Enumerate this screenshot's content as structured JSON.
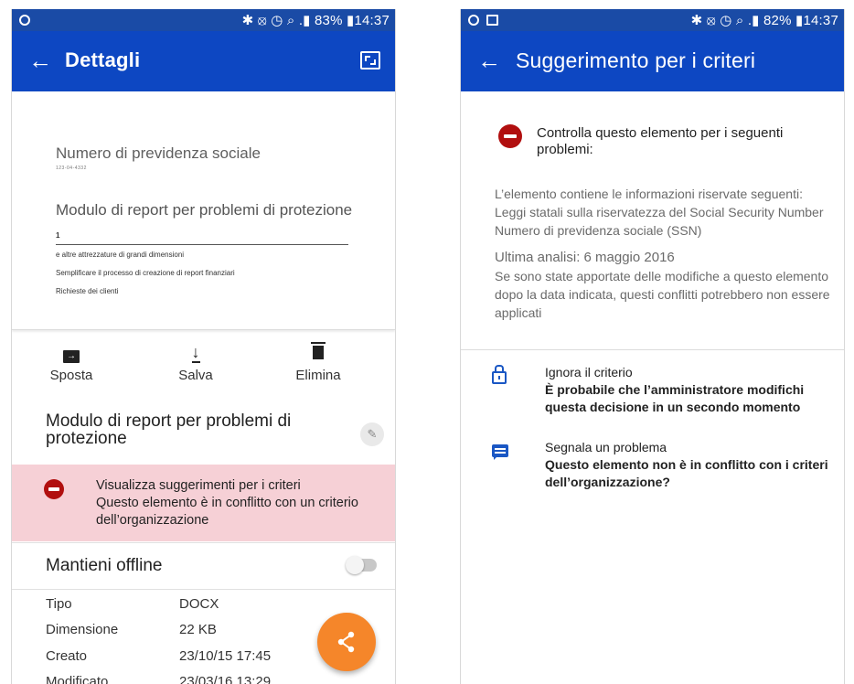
{
  "left": {
    "status_bar": {
      "right": "✱ ⦻ ◷ ⌕ .▮ 83% ▮14:37",
      "battery": "83%",
      "time": "14:37"
    },
    "app_bar": {
      "title": "Dettagli",
      "back_icon": "arrow-left-icon",
      "expand_icon": "expand-icon"
    },
    "preview": {
      "heading1": "Numero di previdenza sociale",
      "scribble": "123-04-4332",
      "heading2": "Modulo di report per problemi di protezione",
      "number": "1",
      "lines": [
        "e altre attrezzature di grandi dimensioni",
        "Semplificare il processo di creazione di report finanziari",
        "Richieste dei clienti"
      ]
    },
    "actions": {
      "move": "Sposta",
      "save": "Salva",
      "delete": "Elimina"
    },
    "file_title": "Modulo di report per problemi di protezione",
    "banner": {
      "title": "Visualizza suggerimenti per i criteri",
      "message": "Questo elemento è in conflitto con un criterio dell’organizzazione",
      "color": "#f6d0d6"
    },
    "offline": {
      "label": "Mantieni offline",
      "enabled": false
    },
    "properties": [
      {
        "label": "Tipo",
        "value": "DOCX"
      },
      {
        "label": "Dimensione",
        "value": "22 KB"
      },
      {
        "label": "Creato",
        "value": "23/10/15 17:45"
      },
      {
        "label": "Modificato",
        "value": "23/03/16 13:29"
      }
    ],
    "fab": {
      "icon": "share-icon",
      "color": "#f5862a"
    }
  },
  "right": {
    "status_bar": {
      "right": "✱ ⦻ ◷ ⌕ .▮ 82% ▮14:37",
      "battery": "82%",
      "time": "14:37"
    },
    "app_bar": {
      "title": "Suggerimento per i criteri",
      "back_icon": "arrow-left-icon"
    },
    "check": "Controlla questo elemento per i seguenti problemi:",
    "info": "L’elemento contiene le informazioni riservate seguenti: Leggi statali sulla riservatezza del Social Security Number Numero di previdenza sociale (SSN)",
    "last_scan": "Ultima analisi: 6 maggio 2016",
    "note": "Se sono state apportate delle modifiche a questo elemento dopo la data indicata, questi conflitti potrebbero non essere applicati",
    "override": {
      "title": "Ignora il criterio",
      "desc": "È probabile che l’amministratore modifichi questa decisione in un secondo momento",
      "icon": "unlock-icon"
    },
    "report": {
      "title": "Segnala un problema",
      "desc": "Questo elemento non è in conflitto con i criteri dell’organizzazione?",
      "icon": "feedback-icon"
    }
  },
  "colors": {
    "appbar": "#0d47c2",
    "statusbar": "#1a4ba6",
    "block": "#b10f0f",
    "accent": "#1a57c4"
  }
}
